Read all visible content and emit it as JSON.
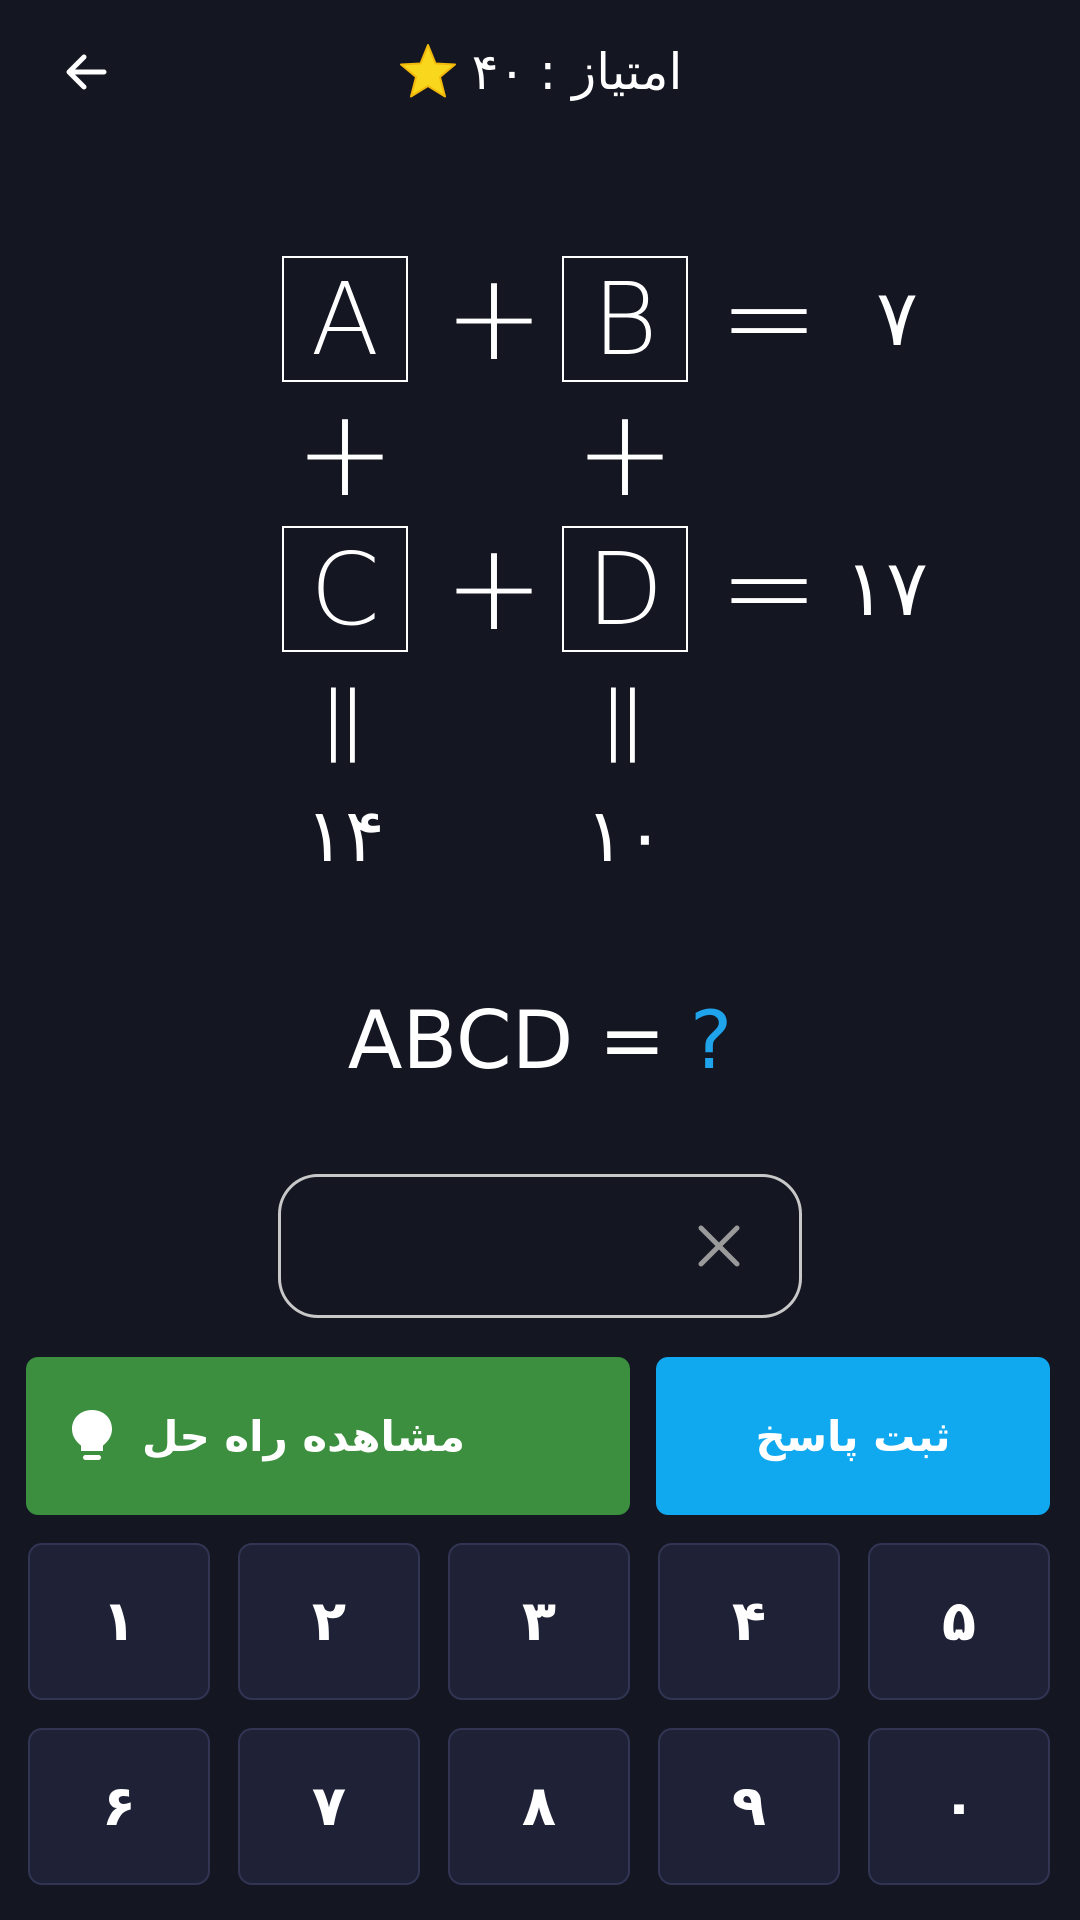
{
  "header": {
    "score_label": "امتیاز :",
    "score_value": "۴۰",
    "back_icon": "arrow-left-icon",
    "star_icon": "star-icon",
    "star_color": "#f9d71c"
  },
  "puzzle": {
    "cells": {
      "a": "A",
      "b": "B",
      "c": "C",
      "d": "D"
    },
    "operator": "+",
    "equals": "=",
    "row_results": [
      "۷",
      "۱۷"
    ],
    "column_results": [
      "۱۴",
      "۱۰"
    ]
  },
  "question": {
    "expression": "ABCD =",
    "unknown": "?",
    "unknown_color": "#1fa3ea"
  },
  "answer_field": {
    "value": "",
    "clear_icon": "close-icon"
  },
  "actions": {
    "show_solution_label": "مشاهده راه حل",
    "show_solution_icon": "lightbulb-icon",
    "submit_label": "ثبت پاسخ"
  },
  "keypad": {
    "row1": [
      "۱",
      "۲",
      "۳",
      "۴",
      "۵"
    ],
    "row2": [
      "۶",
      "۷",
      "۸",
      "۹",
      "۰"
    ]
  }
}
